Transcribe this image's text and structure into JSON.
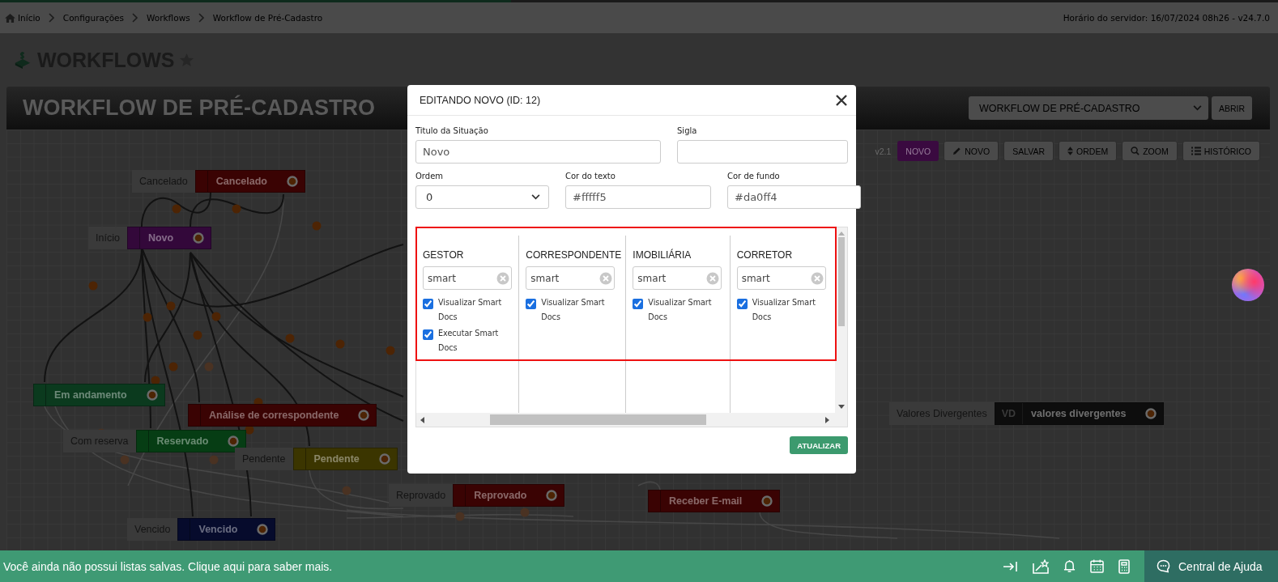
{
  "breadcrumb": [
    {
      "label": "Início",
      "kind": "home"
    },
    {
      "label": "Configurações",
      "kind": "link"
    },
    {
      "label": "Workflows",
      "kind": "link"
    },
    {
      "label": "Workflow de Pré-Cadastro",
      "kind": "link"
    }
  ],
  "server_time": "Horário do servidor: 16/07/2024 08h26 - v24.7.0",
  "page_title": "WORKFLOWS",
  "workflow": {
    "title": "WORKFLOW DE PRÉ-CADASTRO",
    "select": "WORKFLOW DE PRÉ-CADASTRO",
    "open_button": "ABRIR"
  },
  "toolbar": {
    "version": "v2.1",
    "buttons": [
      {
        "label": "NOVO",
        "kind": "status",
        "color": "#3a0a40"
      },
      {
        "label": "NOVO",
        "kind": "pencil"
      },
      {
        "label": "SALVAR",
        "kind": "plain"
      },
      {
        "label": "ORDEM",
        "kind": "sort"
      },
      {
        "label": "ZOOM",
        "kind": "search"
      },
      {
        "label": "HISTÓRICO",
        "kind": "list"
      }
    ]
  },
  "nodes": [
    {
      "label": "Cancelado",
      "title": "Cancelado",
      "color": "#3a0303"
    },
    {
      "label": "Início",
      "title": "Novo",
      "color": "#33083a"
    },
    {
      "title": "Em andamento",
      "color": "#0b3a1e"
    },
    {
      "title": "Análise de correspondente",
      "color": "#3a0303"
    },
    {
      "label": "Com reserva",
      "title": "Reservado",
      "color": "#063d14"
    },
    {
      "label": "Pendente",
      "title": "Pendente",
      "color": "#3b3500"
    },
    {
      "label": "Reprovado",
      "title": "Reprovado",
      "color": "#3a0303"
    },
    {
      "title": "Receber E-mail",
      "color": "#3a0303"
    },
    {
      "label": "Vencido",
      "title": "Vencido",
      "color": "#060b2c"
    },
    {
      "label": "Valores Divergentes",
      "abbr": "VD",
      "title": "valores divergentes",
      "color": "#0d0d0d"
    }
  ],
  "modal": {
    "title": "EDITANDO NOVO (ID: 12)",
    "field_rows": [
      [
        {
          "label": "Titulo da Situação",
          "value": "Novo",
          "kind": "text"
        },
        {
          "label": "Sigla",
          "kind": "text"
        }
      ],
      [
        {
          "label": "Ordem",
          "value": "0",
          "kind": "select"
        },
        {
          "label": "Cor do texto",
          "value": "#fffff5",
          "kind": "text"
        },
        {
          "label": "Cor de fundo",
          "value": "#da0ff4",
          "kind": "text"
        }
      ]
    ],
    "roles": [
      {
        "name": "GESTOR",
        "search": "smart",
        "permissions": [
          {
            "label": "Visualizar Smart Docs",
            "checked": true
          },
          {
            "label": "Executar Smart Docs",
            "checked": true
          }
        ]
      },
      {
        "name": "CORRESPONDENTE",
        "search": "smart",
        "permissions": [
          {
            "label": "Visualizar Smart Docs",
            "checked": true
          }
        ]
      },
      {
        "name": "IMOBILIÁRIA",
        "search": "smart",
        "permissions": [
          {
            "label": "Visualizar Smart Docs",
            "checked": true
          }
        ]
      },
      {
        "name": "CORRETOR",
        "search": "smart",
        "permissions": [
          {
            "label": "Visualizar Smart Docs",
            "checked": true
          }
        ]
      }
    ],
    "submit": "ATUALIZAR"
  },
  "status_bar": {
    "message": "Você ainda não possui listas salvas. Clique aqui para saber mais.",
    "help": "Central de Ajuda"
  }
}
